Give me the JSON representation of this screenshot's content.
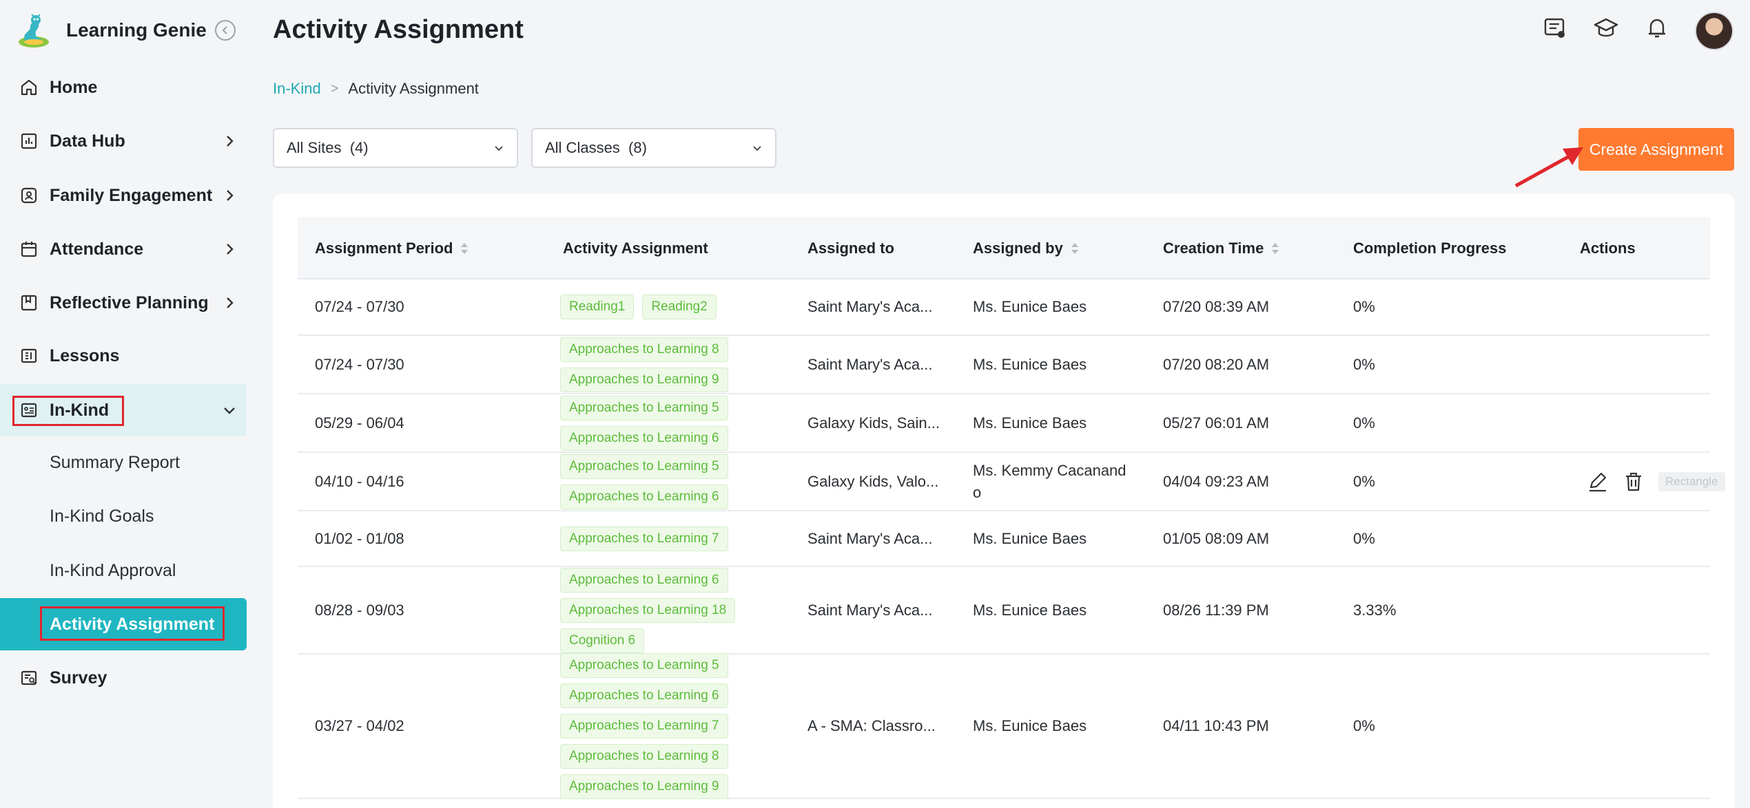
{
  "brand": {
    "name": "Learning Genie"
  },
  "sidebar": {
    "items": [
      {
        "label": "Home"
      },
      {
        "label": "Data Hub"
      },
      {
        "label": "Family Engagement"
      },
      {
        "label": "Attendance"
      },
      {
        "label": "Reflective Planning"
      },
      {
        "label": "Lessons"
      },
      {
        "label": "In-Kind"
      },
      {
        "label": "Survey"
      }
    ],
    "sub_items": [
      {
        "label": "Summary Report"
      },
      {
        "label": "In-Kind Goals"
      },
      {
        "label": "In-Kind Approval"
      },
      {
        "label": "Activity Assignment"
      }
    ]
  },
  "header": {
    "title": "Activity Assignment"
  },
  "breadcrumb": {
    "parent": "In-Kind",
    "separator": ">",
    "current": "Activity Assignment"
  },
  "filters": {
    "sites": "All Sites  (4)",
    "classes": "All Classes  (8)"
  },
  "actions": {
    "create_label": "Create Assignment",
    "tooltip": "Rectangle"
  },
  "colors": {
    "accent": "#1fb6c1",
    "primary_button": "#ff7a2f",
    "tag_green": "#5cbc3a",
    "highlight": "#e0272d"
  },
  "table": {
    "columns": [
      "Assignment Period",
      "Activity Assignment",
      "Assigned to",
      "Assigned by",
      "Creation Time",
      "Completion Progress",
      "Actions"
    ],
    "rows": [
      {
        "period": "07/24 - 07/30",
        "tags": [
          "Reading1",
          "Reading2"
        ],
        "assigned_to": "Saint Mary's Aca...",
        "assigned_by": "Ms. Eunice Baes",
        "created": "07/20 08:39 AM",
        "progress": "0%"
      },
      {
        "period": "07/24 - 07/30",
        "tags": [
          "Approaches to Learning 8",
          "Approaches to Learning 9"
        ],
        "assigned_to": "Saint Mary's Aca...",
        "assigned_by": "Ms. Eunice Baes",
        "created": "07/20 08:20 AM",
        "progress": "0%"
      },
      {
        "period": "05/29 - 06/04",
        "tags": [
          "Approaches to Learning 5",
          "Approaches to Learning 6"
        ],
        "assigned_to": "Galaxy Kids, Sain...",
        "assigned_by": "Ms. Eunice Baes",
        "created": "05/27 06:01 AM",
        "progress": "0%"
      },
      {
        "period": "04/10 - 04/16",
        "tags": [
          "Approaches to Learning 5",
          "Approaches to Learning 6"
        ],
        "assigned_to": "Galaxy Kids, Valo...",
        "assigned_by": "Ms. Kemmy Cacanand\no",
        "created": "04/04 09:23 AM",
        "progress": "0%"
      },
      {
        "period": "01/02 - 01/08",
        "tags": [
          "Approaches to Learning 7"
        ],
        "assigned_to": "Saint Mary's Aca...",
        "assigned_by": "Ms. Eunice Baes",
        "created": "01/05 08:09 AM",
        "progress": "0%"
      },
      {
        "period": "08/28 - 09/03",
        "tags": [
          "Approaches to Learning 6",
          "Approaches to Learning 18",
          "Cognition 6"
        ],
        "assigned_to": "Saint Mary's Aca...",
        "assigned_by": "Ms. Eunice Baes",
        "created": "08/26 11:39 PM",
        "progress": "3.33%"
      },
      {
        "period": "03/27 - 04/02",
        "tags": [
          "Approaches to Learning 5",
          "Approaches to Learning 6",
          "Approaches to Learning 7",
          "Approaches to Learning 8",
          "Approaches to Learning 9"
        ],
        "assigned_to": "A - SMA: Classro...",
        "assigned_by": "Ms. Eunice Baes",
        "created": "04/11 10:43 PM",
        "progress": "0%"
      }
    ]
  }
}
